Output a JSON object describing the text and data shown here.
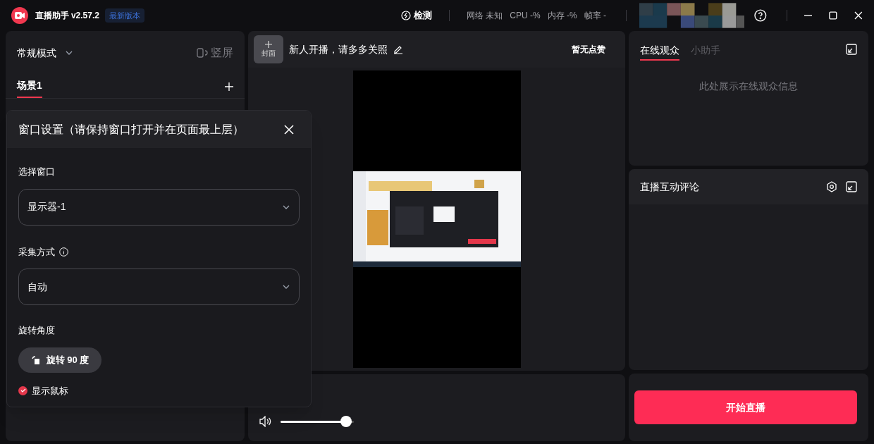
{
  "app": {
    "name": "直播助手",
    "version": "v2.57.2",
    "badge": "最新版本"
  },
  "topbar": {
    "check": "检测",
    "stats": [
      "网络 未知",
      "CPU -%",
      "内存 -%",
      "帧率 -"
    ]
  },
  "left": {
    "mode": "常规模式",
    "orientation": "竖屏",
    "scenes": [
      {
        "label": "场景1",
        "selected": true
      }
    ]
  },
  "center": {
    "cover": "封面",
    "title": "新人开播，请多多关照",
    "likes": "暂无点赞",
    "volume": {
      "level": 0.97
    }
  },
  "right": {
    "tabs": [
      {
        "label": "在线观众",
        "selected": true
      },
      {
        "label": "小助手",
        "selected": false
      }
    ],
    "empty": "此处展示在线观众信息",
    "comments_title": "直播互动评论",
    "start": "开始直播"
  },
  "dialog": {
    "title": "窗口设置（请保持窗口打开并在页面最上层）",
    "fields": [
      {
        "label": "选择窗口",
        "value": "显示器-1",
        "info": false
      },
      {
        "label": "采集方式",
        "value": "自动",
        "info": true
      }
    ],
    "rotate_label": "旋转角度",
    "rotate_button": "旋转 90 度",
    "cursor": {
      "label": "显示鼠标",
      "checked": true
    }
  }
}
